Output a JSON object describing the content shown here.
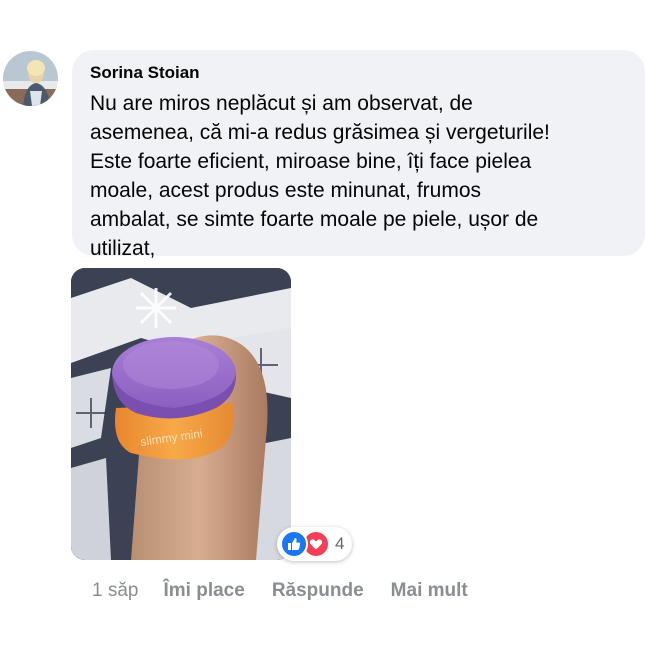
{
  "comment": {
    "author": "Sorina Stoian",
    "text": "Nu are miros neplăcut și am observat, de\nasemenea, că mi-a redus grăsimea și vergeturile!\nEste foarte eficient, miroase bine, îți face pielea\nmoale, acest produs este minunat, frumos\nambalat, se simte foarte moale pe piele, ușor de\nutilizat,",
    "photo": {
      "subject": "purple-lid-orange-jar",
      "jar_label": "slimmy mini"
    },
    "reactions": {
      "icons": [
        "like-icon",
        "love-icon"
      ],
      "count": "4",
      "like_color": "#1877f2",
      "love_color": "#f33e58"
    },
    "actions": {
      "time": "1 săp",
      "like": "Îmi place",
      "reply": "Răspunde",
      "more": "Mai mult"
    }
  },
  "colors": {
    "bubble_bg": "#f0f2f5",
    "text": "#050505",
    "muted": "#8a8d91"
  }
}
